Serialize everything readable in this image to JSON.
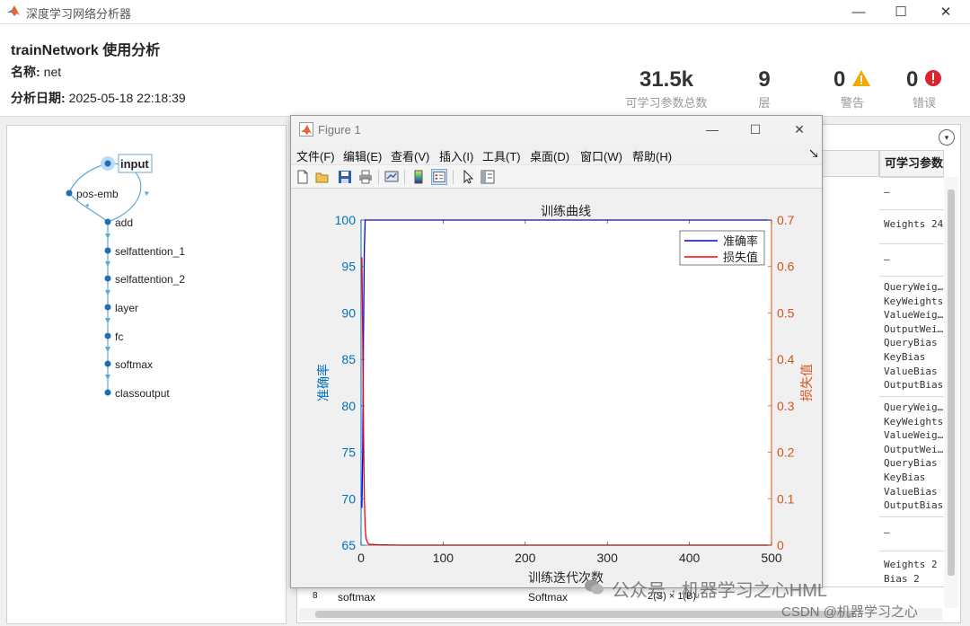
{
  "window": {
    "title": "深度学习网络分析器",
    "minimize_glyph": "—",
    "maximize_glyph": "☐",
    "close_glyph": "✕"
  },
  "header": {
    "title": "trainNetwork 使用分析",
    "name_label": "名称:",
    "name_value": "net",
    "date_label": "分析日期:",
    "date_value": "2025-05-18 22:18:39",
    "stats": {
      "params_value": "31.5k",
      "params_label": "可学习参数总数",
      "layers_value": "9",
      "layers_label": "层",
      "warnings_value": "0",
      "warnings_label": "警告",
      "errors_value": "0",
      "errors_label": "错误"
    },
    "colors": {
      "warning": "#f2a900",
      "error": "#d9262e"
    }
  },
  "graph": {
    "nodes": [
      "input",
      "pos-emb",
      "add",
      "selfattention_1",
      "selfattention_2",
      "layer",
      "fc",
      "softmax",
      "classoutput"
    ],
    "edge_color": "#5aa9d6",
    "node_color": "#1e6fb5"
  },
  "table": {
    "header_params": "可学习参数",
    "dropdown_glyph": "▾",
    "params_cells": [
      [
        "–"
      ],
      [
        "Weights  24"
      ],
      [
        "–"
      ],
      [
        "QueryWeig…",
        "KeyWeights",
        "ValueWeig…",
        "OutputWei…",
        "QueryBias",
        "KeyBias",
        "ValueBias",
        "OutputBias"
      ],
      [
        "QueryWeig…",
        "KeyWeights",
        "ValueWeig…",
        "OutputWei…",
        "QueryBias",
        "KeyBias",
        "ValueBias",
        "OutputBias"
      ],
      [
        "–"
      ],
      [
        "Weights  2",
        "Bias     2"
      ]
    ],
    "bottom_row": {
      "index": "8",
      "name": "softmax",
      "type": "Softmax",
      "activ": "2(S) × 1(B)"
    }
  },
  "figure": {
    "title": "Figure 1",
    "menus": [
      "文件(F)",
      "编辑(E)",
      "查看(V)",
      "插入(I)",
      "工具(T)",
      "桌面(D)",
      "窗口(W)",
      "帮助(H)"
    ],
    "toolbar_icons": [
      "new-figure-icon",
      "open-icon",
      "save-icon",
      "print-icon",
      "link-plot-icon",
      "colorbar-icon",
      "legend-icon",
      "select-pointer-icon",
      "property-editor-icon"
    ]
  },
  "chart_data": {
    "type": "line",
    "title": "训练曲线",
    "xlabel": "训练迭代次数",
    "ylabel_left": "准确率",
    "ylabel_right": "损失值",
    "xlim": [
      0,
      500
    ],
    "ylim_left": [
      65,
      100
    ],
    "ylim_right": [
      0,
      0.7
    ],
    "xticks": [
      0,
      100,
      200,
      300,
      400,
      500
    ],
    "yticks_left": [
      65,
      70,
      75,
      80,
      85,
      90,
      95,
      100
    ],
    "yticks_right": [
      0,
      0.1,
      0.2,
      0.3,
      0.4,
      0.5,
      0.6,
      0.7
    ],
    "legend_position": "top-right",
    "grid": false,
    "left_axis_color": "#0072bd",
    "right_axis_color": "#d95319",
    "series": [
      {
        "name": "准确率",
        "axis": "left",
        "color": "#0000ff",
        "x": [
          1,
          2,
          3,
          4,
          5,
          6,
          10,
          20,
          50,
          100,
          200,
          300,
          400,
          500
        ],
        "y": [
          69,
          75,
          88,
          97,
          100,
          100,
          100,
          100,
          100,
          100,
          100,
          100,
          100,
          100
        ]
      },
      {
        "name": "损失值",
        "axis": "right",
        "color": "#ff0000",
        "x": [
          1,
          2,
          3,
          4,
          5,
          6,
          8,
          10,
          20,
          50,
          100,
          200,
          300,
          400,
          500
        ],
        "y": [
          0.62,
          0.45,
          0.25,
          0.1,
          0.04,
          0.015,
          0.005,
          0.002,
          0.001,
          0,
          0,
          0,
          0,
          0,
          0
        ]
      }
    ]
  },
  "watermark": {
    "text": "公众号 · 机器学习之心HML",
    "csdn": "CSDN @机器学习之心"
  }
}
